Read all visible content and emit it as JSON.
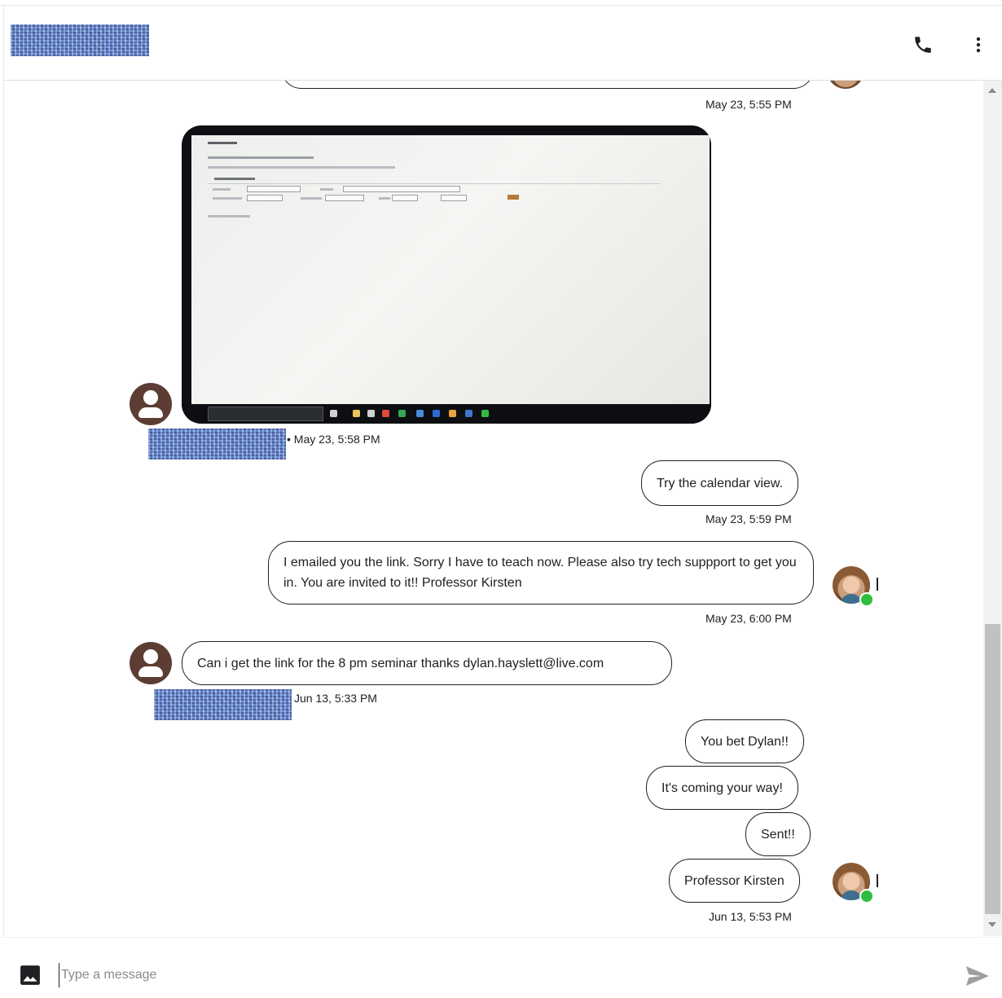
{
  "messages": {
    "m1_time": "May 23, 5:55 PM",
    "m2_time": "• May 23, 5:58 PM",
    "m3_text": "Try the calendar view.",
    "m3_time": "May 23, 5:59 PM",
    "m4_text": "I emailed you the link. Sorry I have to teach now. Please also try tech suppport to get you in. You are invited to it!! Professor Kirsten",
    "m4_time": "May 23, 6:00 PM",
    "m5_text": "Can i get the link for the 8 pm seminar thanks dylan.hayslett@live.com",
    "m5_time": "Jun 13, 5:33 PM",
    "m6_text": "You bet Dylan!!",
    "m7_text": "It's coming your way!",
    "m8_text": "Sent!!",
    "m9_text": "Professor Kirsten",
    "m9_time": "Jun 13, 5:53 PM"
  },
  "composer": {
    "placeholder": "Type a message"
  },
  "icons": {
    "phone": "phone-icon",
    "more": "more-vert-icon",
    "image": "image-icon",
    "send": "send-icon",
    "contact_avatar": "person-icon"
  },
  "colors": {
    "avatar_brown": "#5d3d33",
    "online_green": "#2fbe3f",
    "redaction_blue": "#5b7fc9"
  }
}
